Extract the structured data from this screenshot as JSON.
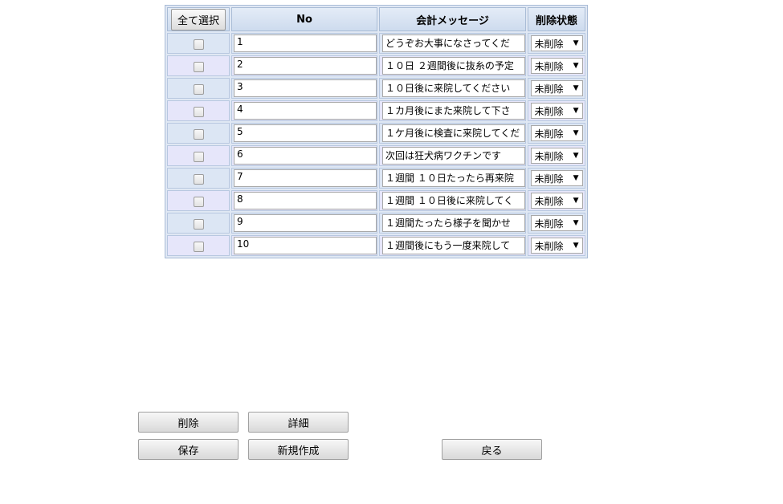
{
  "table": {
    "select_all_label": "全て選択",
    "col_no": "No",
    "col_message": "会計メッセージ",
    "col_state": "削除状態",
    "rows": [
      {
        "no": "1",
        "message": "どうぞお大事になさってくだ",
        "state": "未削除"
      },
      {
        "no": "2",
        "message": "１０日 ２週間後に抜糸の予定",
        "state": "未削除"
      },
      {
        "no": "3",
        "message": "１０日後に来院してください",
        "state": "未削除"
      },
      {
        "no": "4",
        "message": "１カ月後にまた来院して下さ",
        "state": "未削除"
      },
      {
        "no": "5",
        "message": "１ケ月後に検査に来院してくだ",
        "state": "未削除"
      },
      {
        "no": "6",
        "message": "次回は狂犬病ワクチンです",
        "state": "未削除"
      },
      {
        "no": "7",
        "message": "１週間 １０日たったら再来院",
        "state": "未削除"
      },
      {
        "no": "8",
        "message": "１週間 １０日後に来院してく",
        "state": "未削除"
      },
      {
        "no": "9",
        "message": "１週間たったら様子を聞かせ",
        "state": "未削除"
      },
      {
        "no": "10",
        "message": "１週間後にもう一度来院して",
        "state": "未削除"
      }
    ]
  },
  "buttons": {
    "delete": "削除",
    "detail": "詳細",
    "save": "保存",
    "new": "新規作成",
    "back": "戻る"
  }
}
